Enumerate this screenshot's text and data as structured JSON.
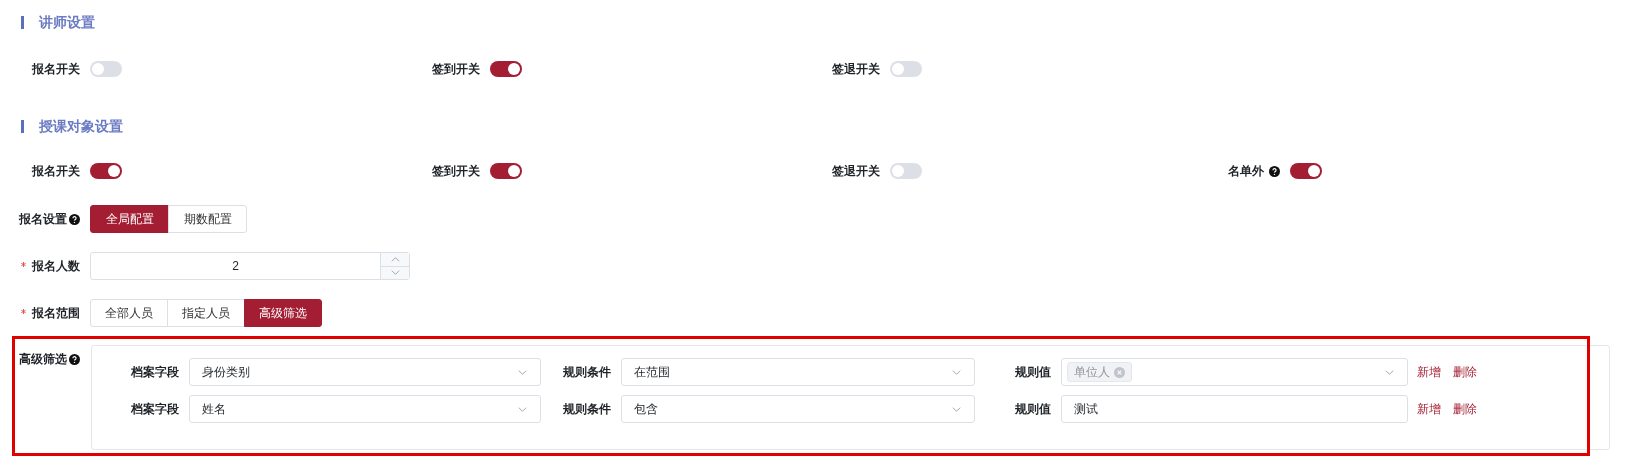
{
  "sections": [
    {
      "title": "讲师设置",
      "switches": [
        {
          "label": "报名开关",
          "on": false
        },
        {
          "label": "签到开关",
          "on": true
        },
        {
          "label": "签退开关",
          "on": false
        }
      ]
    },
    {
      "title": "授课对象设置",
      "switches": [
        {
          "label": "报名开关",
          "on": true
        },
        {
          "label": "签到开关",
          "on": true
        },
        {
          "label": "签退开关",
          "on": false
        },
        {
          "label": "名单外",
          "on": true,
          "help": true
        }
      ]
    }
  ],
  "signup_settings": {
    "label": "报名设置",
    "help": true,
    "options": [
      {
        "label": "全局配置",
        "selected": true
      },
      {
        "label": "期数配置",
        "selected": false
      }
    ]
  },
  "signup_count": {
    "label": "报名人数",
    "required": true,
    "value": "2"
  },
  "signup_scope": {
    "label": "报名范围",
    "required": true,
    "options": [
      {
        "label": "全部人员",
        "selected": false
      },
      {
        "label": "指定人员",
        "selected": false
      },
      {
        "label": "高级筛选",
        "selected": true
      }
    ]
  },
  "advanced_filter": {
    "label": "高级筛选",
    "help": true,
    "rules": [
      {
        "field_label": "档案字段",
        "field": "身份类别",
        "condition_label": "规则条件",
        "condition": "在范围",
        "value_label": "规则值",
        "value": {
          "kind": "tags",
          "tags": [
            "单位人"
          ]
        },
        "actions": [
          "新增",
          "删除"
        ]
      },
      {
        "field_label": "档案字段",
        "field": "姓名",
        "condition_label": "规则条件",
        "condition": "包含",
        "value_label": "规则值",
        "value": {
          "kind": "text",
          "text": "测试"
        },
        "actions": [
          "新增",
          "删除"
        ]
      }
    ]
  }
}
